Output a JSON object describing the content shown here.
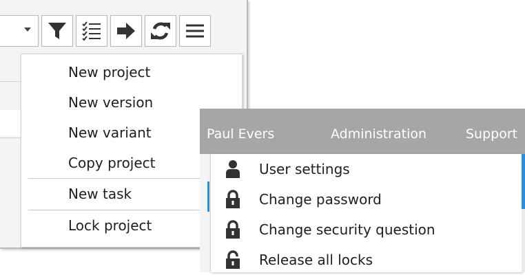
{
  "project_menu": {
    "items": [
      {
        "label": "New project"
      },
      {
        "label": "New version"
      },
      {
        "label": "New variant"
      },
      {
        "label": "Copy project"
      },
      {
        "label": "New task"
      },
      {
        "label": "Lock project"
      }
    ]
  },
  "toolbar": {
    "icons": [
      "filter-icon",
      "checklist-icon",
      "arrow-right-icon",
      "refresh-icon",
      "hamburger-menu-icon"
    ]
  },
  "user_bar": {
    "user_name": "Paul Evers",
    "administration": "Administration",
    "support": "Support"
  },
  "user_menu": {
    "items": [
      {
        "label": "User settings",
        "icon": "user-icon"
      },
      {
        "label": "Change password",
        "icon": "lock-icon"
      },
      {
        "label": "Change security question",
        "icon": "lock-icon"
      },
      {
        "label": "Release all locks",
        "icon": "unlock-icon"
      }
    ]
  },
  "colors": {
    "bar_background": "#a6a6a6",
    "accent_blue": "#2c8ddb",
    "icon_dark": "#333333"
  }
}
